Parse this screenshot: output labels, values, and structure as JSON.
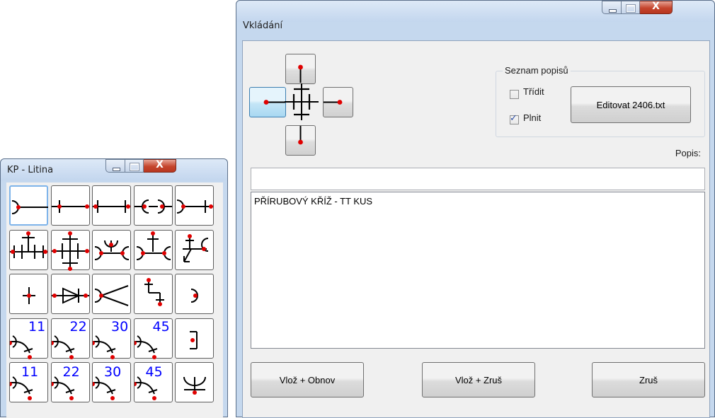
{
  "colors": {
    "symbol_dot": "#e00000",
    "number_blue": "#0000ff",
    "selected_cell": "#7eb4ea"
  },
  "palette": {
    "title": "KP - Litina",
    "controls": {
      "minimize_icon": "minimize-icon",
      "maximize_icon": "maximize-icon",
      "close_label": "X"
    },
    "rows": [
      [
        "flange-end-pipe",
        "pipe-spigot",
        "pipe-double-spigot",
        "double-socket",
        "socket-end-pipe"
      ],
      [
        "flanged-tee",
        "flanged-cross",
        "socket-cross",
        "socket-tee",
        "tee-with-arrow"
      ],
      [
        "single-spigot",
        "valve",
        "socket-reducer",
        "bent-tee",
        "end-cap"
      ],
      [
        "bend-socket-11",
        "bend-socket-22",
        "bend-socket-30",
        "bend-socket-45",
        "plug"
      ],
      [
        "bend-spigot-11",
        "bend-spigot-22",
        "bend-spigot-30",
        "bend-spigot-45",
        "saddle"
      ]
    ],
    "numbers": {
      "r4": [
        "11",
        "22",
        "30",
        "45"
      ],
      "r5": [
        "11",
        "22",
        "30",
        "45"
      ]
    },
    "selected_index": 0
  },
  "dialog": {
    "title": "Vkládání",
    "controls": {
      "close_label": "X"
    },
    "direction_buttons": {
      "top": "up",
      "left": "left",
      "right": "right",
      "bottom": "down",
      "active": "left"
    },
    "group": {
      "label": "Seznam popisů",
      "sort_label": "Třídit",
      "sort_checked": false,
      "fill_label": "Plnit",
      "fill_checked": true,
      "edit_button": "Editovat 2406.txt"
    },
    "popis_label": "Popis:",
    "popis_value": "",
    "list_items": [
      "PŘÍRUBOVÝ KŘÍŽ - TT KUS"
    ],
    "buttons": {
      "insert_refresh": "Vlož + Obnov",
      "insert_cancel": "Vlož + Zruš",
      "cancel": "Zruš"
    }
  }
}
